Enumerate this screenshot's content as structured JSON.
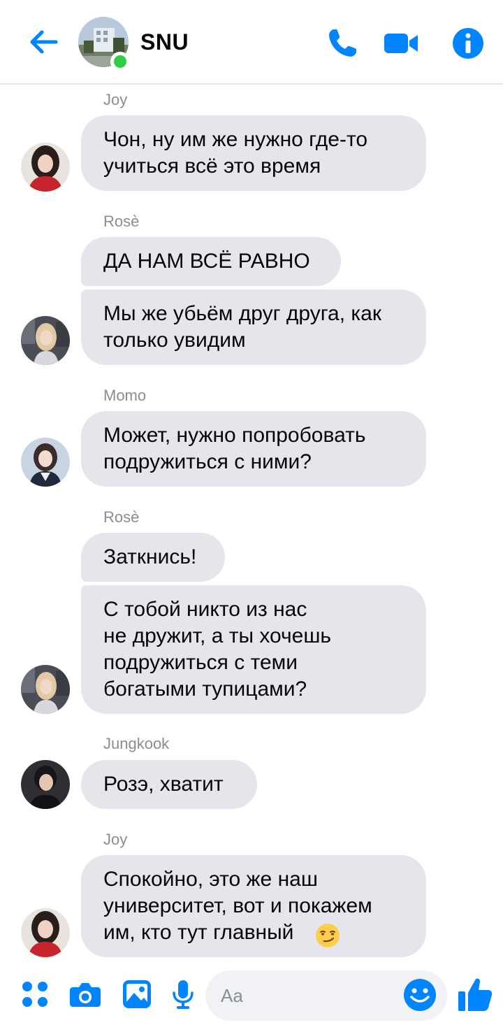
{
  "header": {
    "title": "SNU",
    "online": true,
    "accent_color": "#0084ff",
    "online_color": "#31cc46"
  },
  "messages": [
    {
      "sender": "Joy",
      "bubbles": [
        "Чон, ну им же нужно где-то\nучиться всё это время"
      ]
    },
    {
      "sender": "Rosè",
      "bubbles": [
        "ДА НАМ ВСЁ РАВНО",
        "Мы же убьём друг друга, как\nтолько увидим"
      ]
    },
    {
      "sender": "Momo",
      "bubbles": [
        "Может, нужно попробовать\nподружиться с ними?"
      ]
    },
    {
      "sender": "Rosè",
      "bubbles": [
        "Заткнись!",
        "С тобой никто из нас\nне дружит, а ты хочешь\nподружиться с теми\nбогатыми тупицами?"
      ]
    },
    {
      "sender": "Jungkook",
      "bubbles": [
        "Розэ, хватит"
      ]
    },
    {
      "sender": "Joy",
      "bubbles": [
        "Спокойно, это же наш\nуниверситет, вот и покажем\nим, кто тут главный"
      ]
    }
  ],
  "composer": {
    "placeholder": "Aa"
  },
  "icons": {
    "back": "back-arrow-icon",
    "call": "phone-icon",
    "video": "video-camera-icon",
    "info": "info-icon",
    "menu": "apps-grid-icon",
    "camera": "camera-icon",
    "gallery": "image-icon",
    "mic": "microphone-icon",
    "emoji": "emoji-icon",
    "like": "thumbs-up-icon",
    "smirk": "smirk-emoji-icon"
  }
}
